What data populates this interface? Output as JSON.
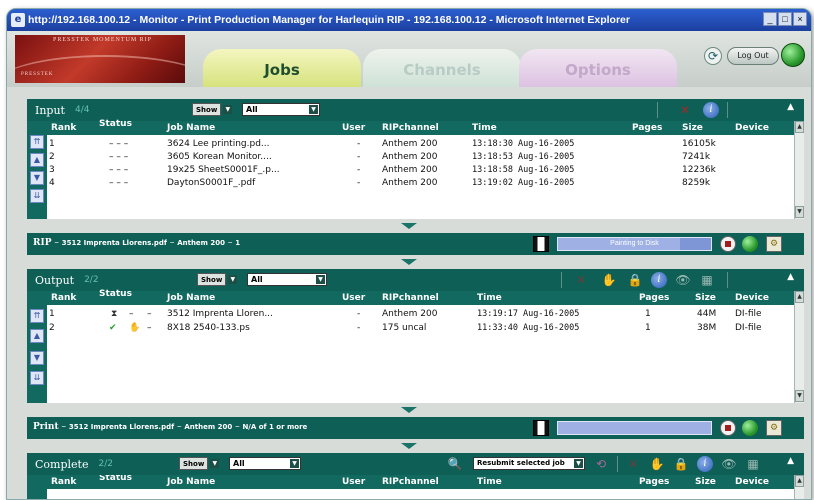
{
  "window": {
    "title": "http://192.168.100.12 - Monitor - Print Production Manager for Harlequin RIP - 192.168.100.12 - Microsoft Internet Explorer",
    "buttons": [
      "_",
      "□",
      "×"
    ]
  },
  "header": {
    "logo_top": "PRESSTEK MOMENTUM RIP",
    "logo_bottom": "PRESSTEK",
    "tabs": [
      "Jobs",
      "Channels",
      "Options"
    ],
    "active_tab": "Jobs",
    "logout_label": "Log Out"
  },
  "columns": {
    "rank": "Rank",
    "status": "Status",
    "job_name": "Job Name",
    "user": "User",
    "ripchannel": "RIPchannel",
    "time": "Time",
    "pages": "Pages",
    "size": "Size",
    "device": "Device"
  },
  "input": {
    "title": "Input",
    "count": "4/4",
    "show_label": "Show",
    "filter_value": "All",
    "rows": [
      {
        "rank": "1",
        "status": "– – –",
        "job_name": "3624 Lee printing.pd...",
        "user": "-",
        "ripchannel": "Anthem 200",
        "time": "13:18:30 Aug-16-2005",
        "pages": "",
        "size": "16105k",
        "device": ""
      },
      {
        "rank": "2",
        "status": "– – –",
        "job_name": "3605 Korean Monitor....",
        "user": "-",
        "ripchannel": "Anthem 200",
        "time": "13:18:53 Aug-16-2005",
        "pages": "",
        "size": "7241k",
        "device": ""
      },
      {
        "rank": "3",
        "status": "– – –",
        "job_name": "19x25 SheetS0001F_.p...",
        "user": "-",
        "ripchannel": "Anthem 200",
        "time": "13:18:58 Aug-16-2005",
        "pages": "",
        "size": "12236k",
        "device": ""
      },
      {
        "rank": "4",
        "status": "– – –",
        "job_name": "DaytonS0001F_.pdf",
        "user": "-",
        "ripchannel": "Anthem 200",
        "time": "13:19:02 Aug-16-2005",
        "pages": "",
        "size": "8259k",
        "device": ""
      }
    ]
  },
  "rip": {
    "label": "RIP",
    "job": "3512 Imprenta Llorens.pdf",
    "channel": "Anthem 200",
    "count": "1",
    "progress_label": "Painting to Disk",
    "progress": 0.8
  },
  "output": {
    "title": "Output",
    "count": "2/2",
    "show_label": "Show",
    "filter_value": "All",
    "rows": [
      {
        "rank": "1",
        "status": "hourglass",
        "job_name": "3512 Imprenta Lloren...",
        "user": "-",
        "ripchannel": "Anthem 200",
        "time": "13:19:17 Aug-16-2005",
        "pages": "1",
        "size": "44M",
        "device": "DI-file"
      },
      {
        "rank": "2",
        "status": "check",
        "job_name": "8X18 2540-133.ps",
        "user": "-",
        "ripchannel": "175 uncal",
        "time": "11:33:40 Aug-16-2005",
        "pages": "1",
        "size": "38M",
        "device": "DI-file"
      }
    ]
  },
  "print": {
    "label": "Print",
    "job": "3512 Imprenta Llorens.pdf",
    "channel": "Anthem 200",
    "status": "N/A of 1 or more",
    "progress": 1.0
  },
  "complete": {
    "title": "Complete",
    "count": "2/2",
    "show_label": "Show",
    "filter_value": "All",
    "resubmit_label": "Resubmit selected job"
  },
  "colors": {
    "panel": "#0e5f56",
    "active_tab": "#d6e27d",
    "progress": "#7e95d6"
  }
}
